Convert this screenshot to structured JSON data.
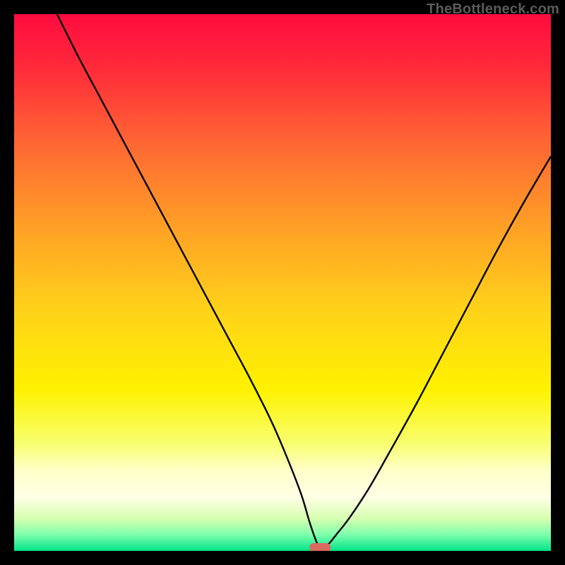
{
  "watermark": "TheBottleneck.com",
  "colors": {
    "black": "#000000",
    "curve": "#000000",
    "marker_fill": "#d96a5f",
    "gradient_stops": [
      {
        "offset": 0.0,
        "color": "#ff0b3f"
      },
      {
        "offset": 0.1,
        "color": "#ff2a3a"
      },
      {
        "offset": 0.25,
        "color": "#ff6a33"
      },
      {
        "offset": 0.4,
        "color": "#ffa125"
      },
      {
        "offset": 0.55,
        "color": "#ffd21a"
      },
      {
        "offset": 0.7,
        "color": "#fff200"
      },
      {
        "offset": 0.8,
        "color": "#f8ff70"
      },
      {
        "offset": 0.85,
        "color": "#ffffc8"
      },
      {
        "offset": 0.9,
        "color": "#ffffe6"
      },
      {
        "offset": 0.94,
        "color": "#d6ffb0"
      },
      {
        "offset": 0.97,
        "color": "#7dffac"
      },
      {
        "offset": 1.0,
        "color": "#00e58a"
      }
    ]
  },
  "chart_data": {
    "type": "line",
    "title": "",
    "xlabel": "",
    "ylabel": "",
    "xlim": [
      0,
      100
    ],
    "ylim": [
      0,
      100
    ],
    "grid": false,
    "marker": {
      "x": 57,
      "y": 0
    },
    "series": [
      {
        "name": "left-branch",
        "x": [
          8,
          12,
          16,
          20,
          24,
          28,
          32,
          36,
          40,
          44,
          48,
          51,
          53.5,
          55,
          56.2,
          57
        ],
        "y": [
          100,
          92,
          84.5,
          77,
          69.5,
          62,
          54.5,
          47,
          39.5,
          32,
          24,
          17,
          10.5,
          5.5,
          2.0,
          0.2
        ]
      },
      {
        "name": "right-branch",
        "x": [
          57,
          58.5,
          60,
          62.5,
          66,
          70,
          75,
          80,
          85,
          90,
          95,
          100
        ],
        "y": [
          0.2,
          1.2,
          3.0,
          6.2,
          11.5,
          18.5,
          27.5,
          37,
          46.5,
          56,
          65,
          73.5
        ]
      }
    ]
  }
}
